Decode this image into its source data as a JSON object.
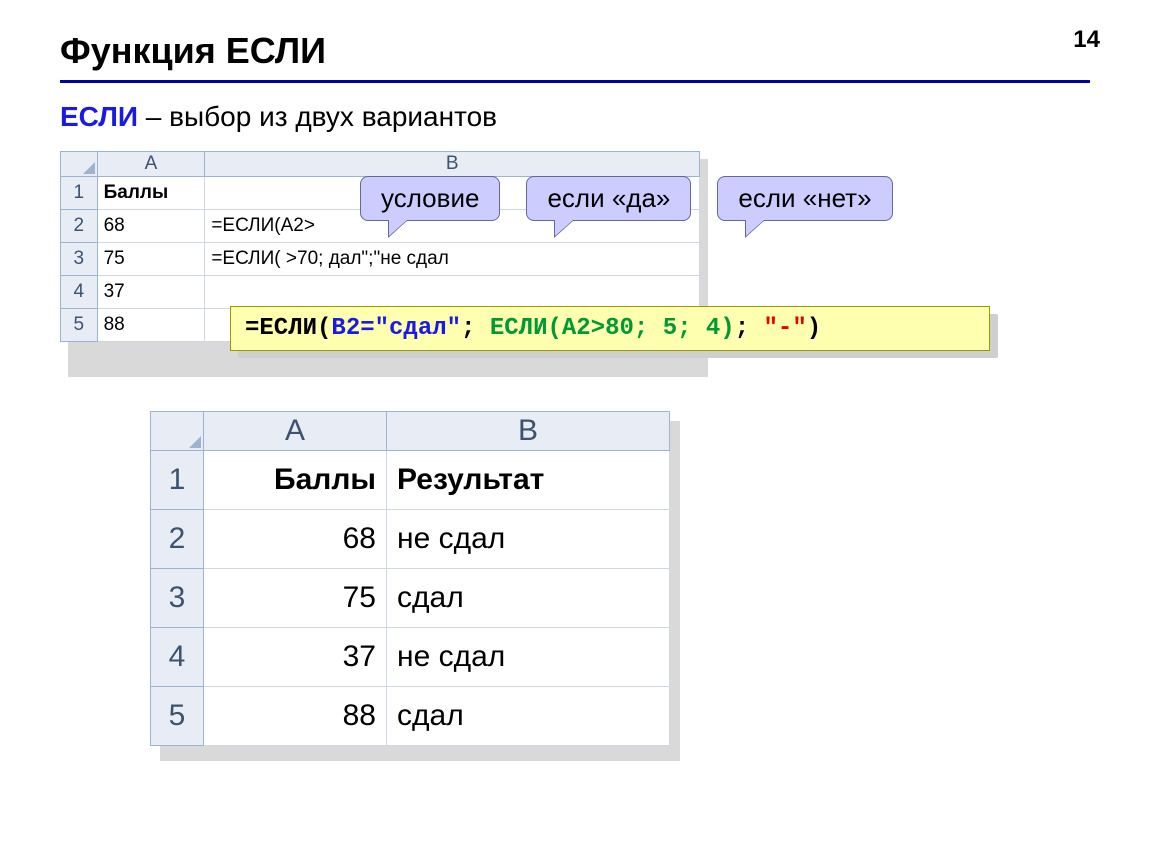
{
  "page_number": "14",
  "title": "Функция ЕСЛИ",
  "subtitle_keyword": "ЕСЛИ",
  "subtitle_rest": " – выбор из двух вариантов",
  "table1": {
    "col_labels": [
      "A",
      "B"
    ],
    "row_labels": [
      "1",
      "2",
      "3",
      "4",
      "5"
    ],
    "header_cell": "Баллы",
    "rows": [
      {
        "A": "68",
        "B": "=ЕСЛИ(A2>"
      },
      {
        "A": "75",
        "B": "=ЕСЛИ(   >70;    дал\";\"не сдал"
      },
      {
        "A": "37",
        "B": ""
      },
      {
        "A": "88",
        "B": ""
      }
    ]
  },
  "callouts": {
    "cond": "условие",
    "yes": "если «да»",
    "no": "если «нет»"
  },
  "formula": {
    "p1": "=ЕСЛИ(",
    "blue": "B2=\"сдал\"",
    "sep1": "; ",
    "green": "ЕСЛИ(A2>80; 5; 4)",
    "sep2": "; ",
    "red": "\"-\"",
    "p2": ")"
  },
  "table2": {
    "col_labels": [
      "A",
      "B"
    ],
    "row_labels": [
      "1",
      "2",
      "3",
      "4",
      "5"
    ],
    "headers": {
      "A": "Баллы",
      "B": "Результат"
    },
    "rows": [
      {
        "A": "68",
        "B": "не сдал"
      },
      {
        "A": "75",
        "B": "сдал"
      },
      {
        "A": "37",
        "B": "не сдал"
      },
      {
        "A": "88",
        "B": "сдал"
      }
    ]
  }
}
